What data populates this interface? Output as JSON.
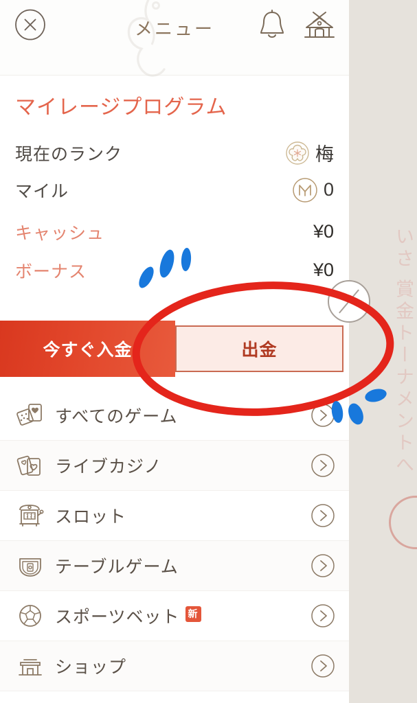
{
  "header": {
    "title": "メニュー",
    "close_icon": "close-circle-icon",
    "bell_icon": "bell-icon",
    "home_icon": "shrine-home-icon"
  },
  "mileage": {
    "program_title": "マイレージプログラム",
    "rank": {
      "label": "現在のランク",
      "icon": "plum-blossom-icon",
      "value": "梅"
    },
    "miles": {
      "label": "マイル",
      "icon": "mile-m-icon",
      "value": "0"
    }
  },
  "balances": [
    {
      "label": "キャッシュ",
      "value": "¥0"
    },
    {
      "label": "ボーナス",
      "value": "¥0"
    }
  ],
  "actions": {
    "deposit_label": "今すぐ入金",
    "withdraw_label": "出金"
  },
  "nav_items": [
    {
      "label": "すべてのゲーム",
      "icon": "dice-cards-icon",
      "badge": ""
    },
    {
      "label": "ライブカジノ",
      "icon": "playing-cards-icon",
      "badge": ""
    },
    {
      "label": "スロット",
      "icon": "slot-machine-icon",
      "badge": ""
    },
    {
      "label": "テーブルゲーム",
      "icon": "table-game-shield-icon",
      "badge": ""
    },
    {
      "label": "スポーツベット",
      "icon": "soccer-ball-icon",
      "badge": "新"
    },
    {
      "label": "ショップ",
      "icon": "shop-store-icon",
      "badge": ""
    }
  ],
  "background": {
    "vertical_text": "いさ 賞金トーナメントへ"
  },
  "colors": {
    "brand_red": "#e4654c",
    "deposit_red": "#d9381f",
    "withdraw_bg": "#fcebe6",
    "withdraw_border": "#c96a52",
    "withdraw_text": "#b03a22",
    "icon_brown": "#8c7a66",
    "badge_red": "#e4563a",
    "panel_bg": "#ffffff",
    "page_bg": "#e6e2dc",
    "annotation_red": "#e4251b",
    "annotation_blue": "#1878dc"
  }
}
